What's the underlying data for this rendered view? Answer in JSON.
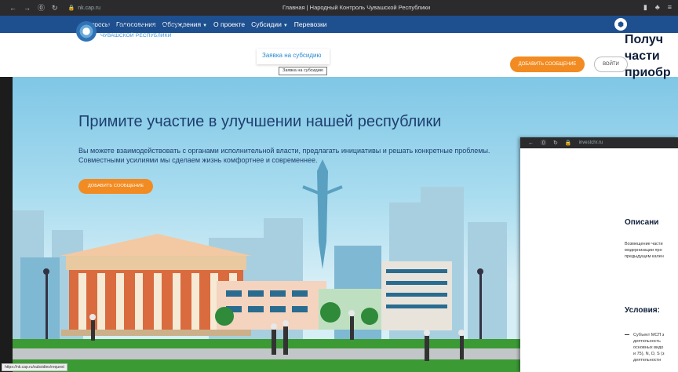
{
  "browser": {
    "url": "nk.cap.ru",
    "title": "Главная | Народный Контроль Чувашской Республики"
  },
  "nav": {
    "items": [
      {
        "label": "Опросы"
      },
      {
        "label": "Голосования"
      },
      {
        "label": "Обсуждения"
      },
      {
        "label": "О проекте"
      },
      {
        "label": "Субсидии"
      },
      {
        "label": "Перевозки"
      }
    ]
  },
  "header": {
    "logo_line1": "НАРОДНЫЙ КОНТРОЛЬ",
    "logo_line2": "ЧУВАШСКОЙ РЕСПУБЛИКИ",
    "add_message": "ДОБАВИТЬ СООБЩЕНИЕ",
    "login": "ВОЙТИ",
    "dropdown_item": "Заявка на субсидию",
    "tooltip": "Заявка на субсидию"
  },
  "hero": {
    "title": "Примите участие в улучшении нашей республики",
    "subtitle": "Вы можете взаимодействовать с органами исполнительной власти, предлагать инициативы и решать конкретные проблемы. Совместными усилиями мы сделаем жизнь комфортнее и современнее.",
    "button": "ДОБАВИТЬ СООБЩЕНИЕ"
  },
  "status_url": "https://nk.cap.ru/subsidies/request",
  "window2": {
    "url": "investchr.ru",
    "heading_lines": [
      "Получ",
      "части",
      "приобр"
    ],
    "section1": "Описани",
    "para_lines": [
      "Возмещение части",
      "модернизации про",
      "предыдущем кален"
    ],
    "section2": "Условия:",
    "list_lines": [
      "Субъект МСП з",
      "деятельность",
      "основных видо",
      "и 75), N, O, S (з",
      "деятельности"
    ]
  }
}
